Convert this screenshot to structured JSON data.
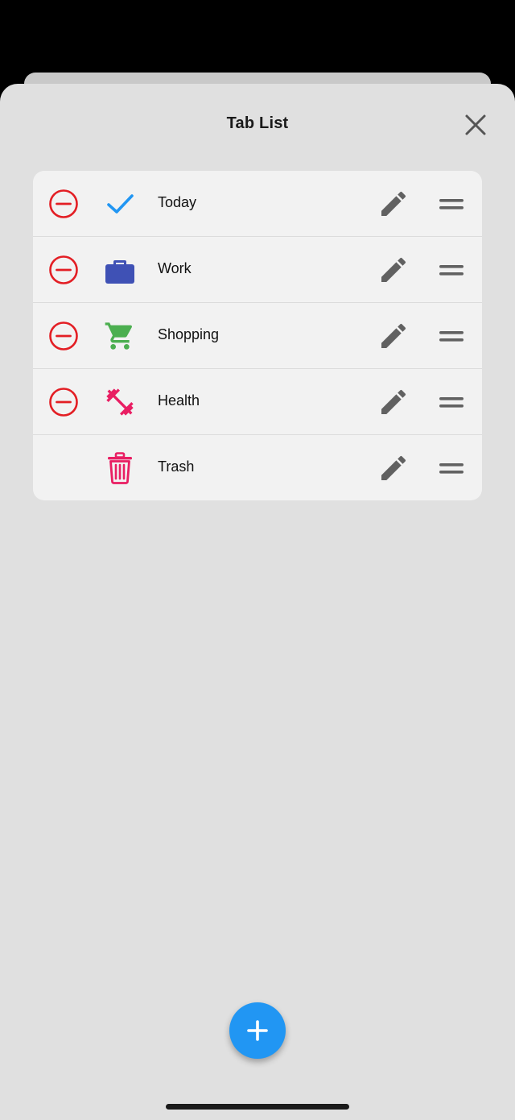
{
  "sheet": {
    "title": "Tab List"
  },
  "tabs": [
    {
      "label": "Today",
      "icon": "check-icon",
      "color": "#2196f3",
      "removable": true
    },
    {
      "label": "Work",
      "icon": "briefcase-icon",
      "color": "#3f51b5",
      "removable": true
    },
    {
      "label": "Shopping",
      "icon": "cart-icon",
      "color": "#4caf50",
      "removable": true
    },
    {
      "label": "Health",
      "icon": "dumbbell-icon",
      "color": "#e91e63",
      "removable": true
    },
    {
      "label": "Trash",
      "icon": "trash-icon",
      "color": "#e91e63",
      "removable": false
    }
  ],
  "colors": {
    "accent": "#2196f3",
    "remove": "#e31e24",
    "action_icon": "#616161",
    "sheet_bg": "#e0e0e0",
    "list_bg": "#f2f2f2"
  },
  "icons": {
    "close": "close-icon",
    "remove": "minus-circle-icon",
    "edit": "pencil-icon",
    "drag": "drag-handle-icon",
    "add": "plus-icon"
  }
}
